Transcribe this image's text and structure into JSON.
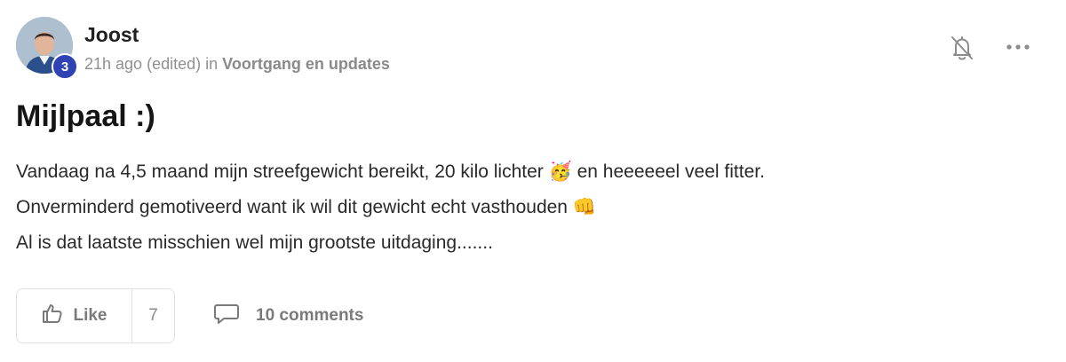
{
  "post": {
    "author": "Joost",
    "level_badge": "3",
    "time": "21h ago",
    "edited": "(edited)",
    "in_label": "in",
    "category": "Voortgang en updates",
    "title": "Mijlpaal :)",
    "body_lines": [
      {
        "text": "Vandaag na 4,5 maand mijn streefgewicht bereikt, 20 kilo lichter ",
        "emoji": "🥳",
        "after": " en heeeeeel veel fitter."
      },
      {
        "text": "Onverminderd gemotiveerd want ik wil dit gewicht echt vasthouden ",
        "emoji": "👊",
        "after": ""
      },
      {
        "text": "Al is dat laatste misschien wel mijn grootste uitdaging.......",
        "emoji": "",
        "after": ""
      }
    ]
  },
  "actions": {
    "like_label": "Like",
    "like_count": "7",
    "comments_label": "10 comments"
  },
  "icons": {
    "bell": "bell-off-icon",
    "more": "more-horizontal-icon",
    "like": "thumbs-up-icon",
    "comment": "comment-icon"
  },
  "colors": {
    "badge": "#2f43b5",
    "muted_text": "#909090"
  }
}
